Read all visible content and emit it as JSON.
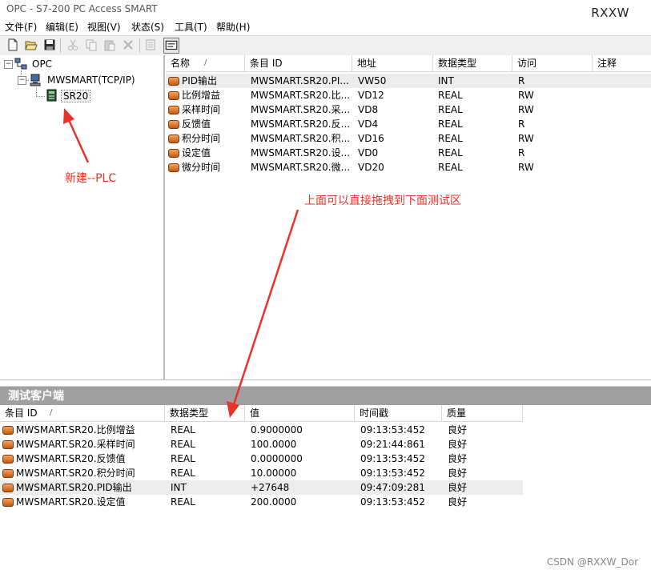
{
  "window": {
    "title": "OPC - S7-200 PC Access SMART",
    "user": "RXXW"
  },
  "menu": [
    "文件(F)",
    "编辑(E)",
    "视图(V)",
    "状态(S)",
    "工具(T)",
    "帮助(H)"
  ],
  "toolbar": [
    "new-icon",
    "open-icon",
    "save-icon",
    "cut-icon",
    "copy-icon",
    "paste-icon",
    "delete-icon",
    "properties-icon",
    "test-client-icon"
  ],
  "tree": {
    "root": "OPC",
    "plc_connection": "MWSMART(TCP/IP)",
    "plc": "SR20"
  },
  "items_table": {
    "columns": [
      "名称",
      "条目 ID",
      "地址",
      "数据类型",
      "访问",
      "注释"
    ],
    "sort_indicator": "/",
    "rows": [
      {
        "name": "PID输出",
        "id": "MWSMART.SR20.PI...",
        "addr": "VW50",
        "type": "INT",
        "access": "R"
      },
      {
        "name": "比例增益",
        "id": "MWSMART.SR20.比...",
        "addr": "VD12",
        "type": "REAL",
        "access": "RW"
      },
      {
        "name": "采样时间",
        "id": "MWSMART.SR20.采...",
        "addr": "VD8",
        "type": "REAL",
        "access": "RW"
      },
      {
        "name": "反馈值",
        "id": "MWSMART.SR20.反...",
        "addr": "VD4",
        "type": "REAL",
        "access": "R"
      },
      {
        "name": "积分时间",
        "id": "MWSMART.SR20.积...",
        "addr": "VD16",
        "type": "REAL",
        "access": "RW"
      },
      {
        "name": "设定值",
        "id": "MWSMART.SR20.设...",
        "addr": "VD0",
        "type": "REAL",
        "access": "R"
      },
      {
        "name": "微分时间",
        "id": "MWSMART.SR20.微...",
        "addr": "VD20",
        "type": "REAL",
        "access": "RW"
      }
    ]
  },
  "test_client": {
    "title": "测试客户端",
    "columns": [
      "条目 ID",
      "数据类型",
      "值",
      "时间戳",
      "质量"
    ],
    "sort_indicator": "/",
    "rows": [
      {
        "id": "MWSMART.SR20.比例增益",
        "type": "REAL",
        "value": "0.9000000",
        "time": "09:13:53:452",
        "quality": "良好"
      },
      {
        "id": "MWSMART.SR20.采样时间",
        "type": "REAL",
        "value": "100.0000",
        "time": "09:21:44:861",
        "quality": "良好"
      },
      {
        "id": "MWSMART.SR20.反馈值",
        "type": "REAL",
        "value": "0.0000000",
        "time": "09:13:53:452",
        "quality": "良好"
      },
      {
        "id": "MWSMART.SR20.积分时间",
        "type": "REAL",
        "value": "10.00000",
        "time": "09:13:53:452",
        "quality": "良好"
      },
      {
        "id": "MWSMART.SR20.PID输出",
        "type": "INT",
        "value": "+27648",
        "time": "09:47:09:281",
        "quality": "良好"
      },
      {
        "id": "MWSMART.SR20.设定值",
        "type": "REAL",
        "value": "200.0000",
        "time": "09:13:53:452",
        "quality": "良好"
      }
    ]
  },
  "annotations": {
    "new_plc": "新建--PLC",
    "drag_hint": "上面可以直接拖拽到下面测试区"
  },
  "watermark": "CSDN @RXXW_Dor",
  "colors": {
    "annotation": "#e8332a",
    "panel_title_bg": "#a0a0a0",
    "item_icon": "#d9742c"
  }
}
